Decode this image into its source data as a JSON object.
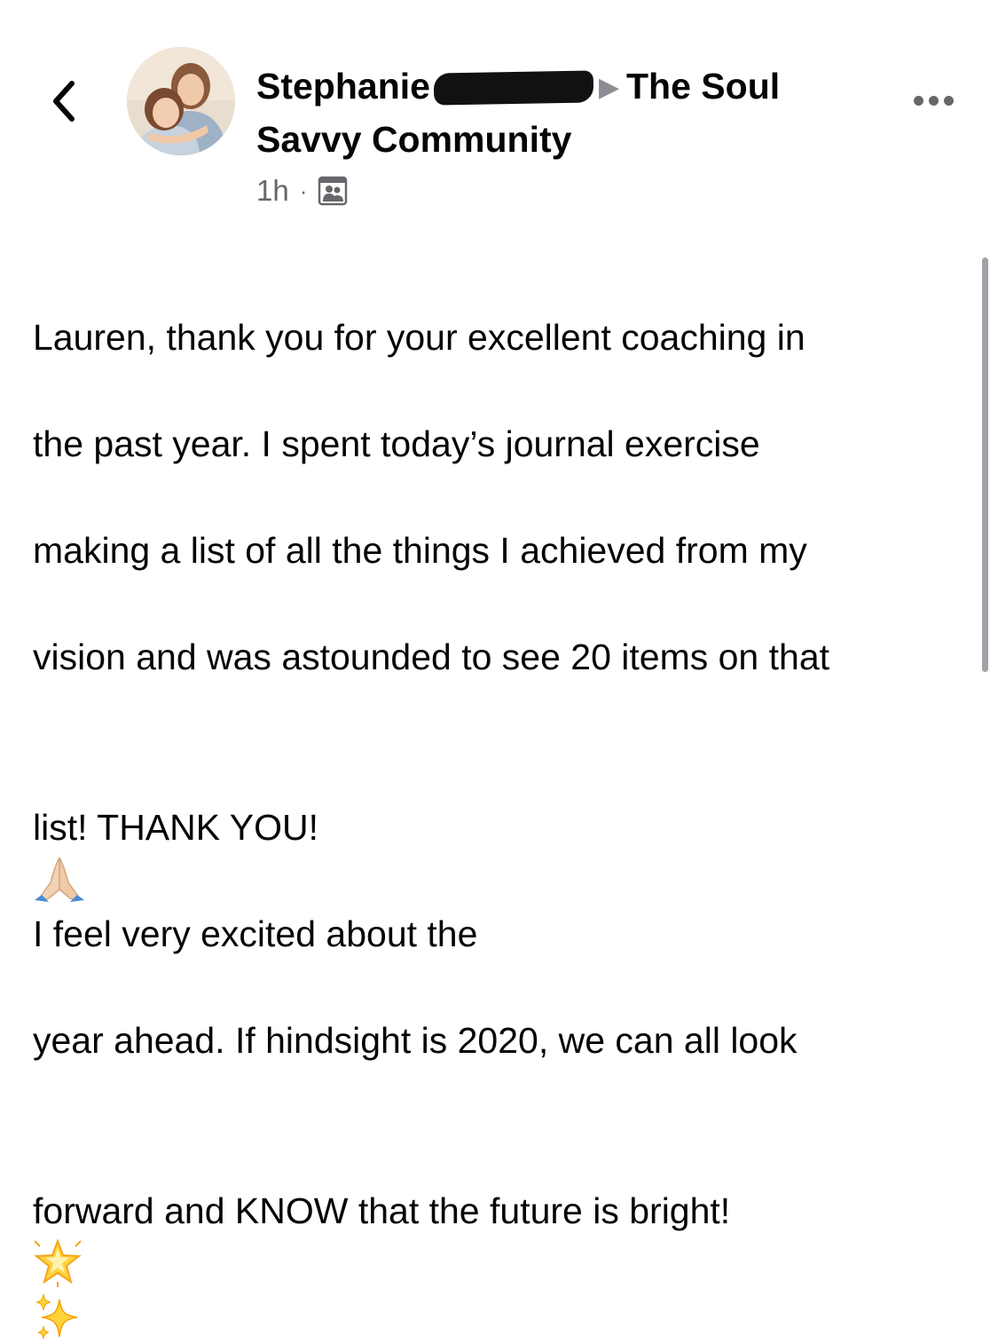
{
  "header": {
    "author_name": "Stephanie",
    "separator_arrow": "▶",
    "group_name": "The Soul Savvy Community",
    "timestamp": "1h",
    "meta_separator": "·",
    "audience_icon": "group-audience-icon"
  },
  "icons": {
    "back": "chevron-left-icon",
    "more": "more-options-icon",
    "pray": "folded-hands-emoji",
    "star": "glowing-star-emoji",
    "sparkles": "sparkles-emoji"
  },
  "post": {
    "line1": "Lauren, thank you for your excellent coaching in",
    "line2": "the past year. I spent today’s journal exercise",
    "line3": "making a list of all the things I achieved from my",
    "line4": "vision and was astounded to see 20 items on that",
    "line5a": "list! THANK YOU!",
    "line5b": "I feel very excited about the",
    "line6": "year ahead. If hindsight is 2020, we can all look",
    "line7": "forward and KNOW that the future is bright!"
  },
  "colors": {
    "text": "#050505",
    "secondary": "#65676b",
    "scrollbar": "#9fa2a6"
  }
}
